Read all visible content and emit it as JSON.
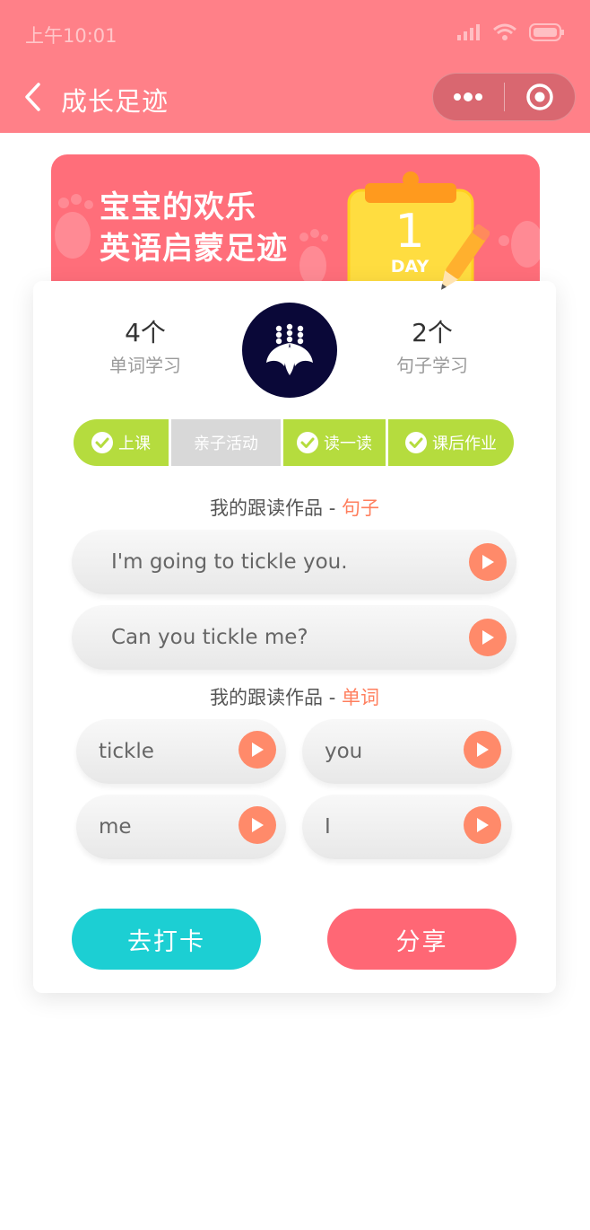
{
  "status": {
    "time": "上午10:01"
  },
  "nav": {
    "title": "成长足迹"
  },
  "banner": {
    "line1": "宝宝的欢乐",
    "line2": "英语启蒙足迹",
    "day_number": "1",
    "day_label": "DAY"
  },
  "stats": {
    "words": {
      "count": "4个",
      "label": "单词学习"
    },
    "sentences": {
      "count": "2个",
      "label": "句子学习"
    }
  },
  "steps": [
    {
      "label": "上课",
      "done": true
    },
    {
      "label": "亲子活动",
      "done": false
    },
    {
      "label": "读一读",
      "done": true
    },
    {
      "label": "课后作业",
      "done": true
    }
  ],
  "sentence_section": {
    "prefix": "我的跟读作品 - ",
    "highlight": "句子"
  },
  "sentences": [
    "I'm going to tickle you.",
    "Can you tickle me?"
  ],
  "word_section": {
    "prefix": "我的跟读作品 - ",
    "highlight": "单词"
  },
  "words": [
    "tickle",
    "you",
    "me",
    "I"
  ],
  "buttons": {
    "checkin": "去打卡",
    "share": "分享"
  },
  "colors": {
    "header": "#ff8088",
    "check_done": "#b5dc3e",
    "play": "#ff8a6a",
    "checkin_button": "#1ccfd3",
    "share_button": "#ff6775"
  }
}
